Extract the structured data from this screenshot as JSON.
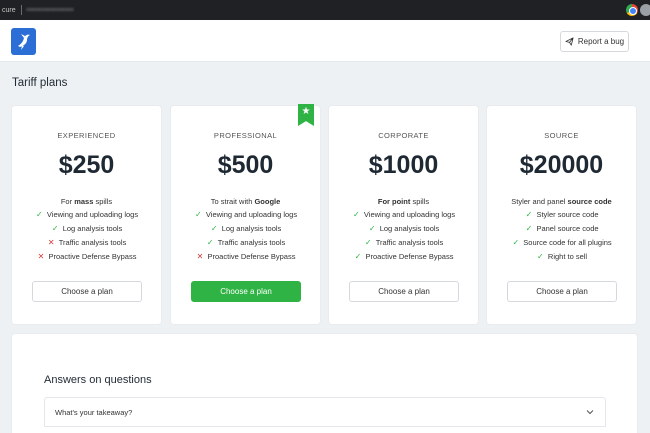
{
  "browser": {
    "secure_text": "cure",
    "url_text": "••••••••••••••••"
  },
  "header": {
    "report_label": "Report a bug"
  },
  "page": {
    "title": "Tariff plans"
  },
  "colors": {
    "accent": "#2fb344",
    "danger": "#d63939",
    "brand": "#2b6fd6"
  },
  "plans": [
    {
      "name": "EXPERIENCED",
      "price": "$250",
      "tag_pre": "For ",
      "tag_bold": "mass",
      "tag_post": " spills",
      "features": [
        {
          "text": "Viewing and uploading logs",
          "included": true,
          "mark": "✓"
        },
        {
          "text": "Log analysis tools",
          "included": true,
          "mark": "✓"
        },
        {
          "text": "Traffic analysis tools",
          "included": false,
          "mark": "✕"
        },
        {
          "text": "Proactive Defense Bypass",
          "included": false,
          "mark": "✕"
        }
      ],
      "button": "Choose a plan",
      "featured": false
    },
    {
      "name": "PROFESSIONAL",
      "price": "$500",
      "tag_pre": "To strait with ",
      "tag_bold": "Google",
      "tag_post": "",
      "features": [
        {
          "text": "Viewing and uploading logs",
          "included": true,
          "mark": "✓"
        },
        {
          "text": "Log analysis tools",
          "included": true,
          "mark": "✓"
        },
        {
          "text": "Traffic analysis tools",
          "included": true,
          "mark": "✓"
        },
        {
          "text": "Proactive Defense Bypass",
          "included": false,
          "mark": "✕"
        }
      ],
      "button": "Choose a plan",
      "featured": true
    },
    {
      "name": "CORPORATE",
      "price": "$1000",
      "tag_pre": "",
      "tag_bold": "For point",
      "tag_post": " spills",
      "features": [
        {
          "text": "Viewing and uploading logs",
          "included": true,
          "mark": "✓"
        },
        {
          "text": "Log analysis tools",
          "included": true,
          "mark": "✓"
        },
        {
          "text": "Traffic analysis tools",
          "included": true,
          "mark": "✓"
        },
        {
          "text": "Proactive Defense Bypass",
          "included": true,
          "mark": "✓"
        }
      ],
      "button": "Choose a plan",
      "featured": false
    },
    {
      "name": "SOURCE",
      "price": "$20000",
      "tag_pre": "Styler and panel ",
      "tag_bold": "source code",
      "tag_post": "",
      "features": [
        {
          "text": "Styler source code",
          "included": true,
          "mark": "✓"
        },
        {
          "text": "Panel source code",
          "included": true,
          "mark": "✓"
        },
        {
          "text": "Source code for all plugins",
          "included": true,
          "mark": "✓"
        },
        {
          "text": "Right to sell",
          "included": true,
          "mark": "✓"
        }
      ],
      "button": "Choose a plan",
      "featured": false
    }
  ],
  "faq": {
    "title": "Answers on questions",
    "items": [
      {
        "question": "What's your takeaway?"
      }
    ]
  },
  "icons": {
    "logo": "bird-logo-icon",
    "report": "paper-plane-icon",
    "ribbon": "star-icon",
    "faq_toggle": "chevron-down-icon",
    "ribbon_glyph": "★"
  }
}
